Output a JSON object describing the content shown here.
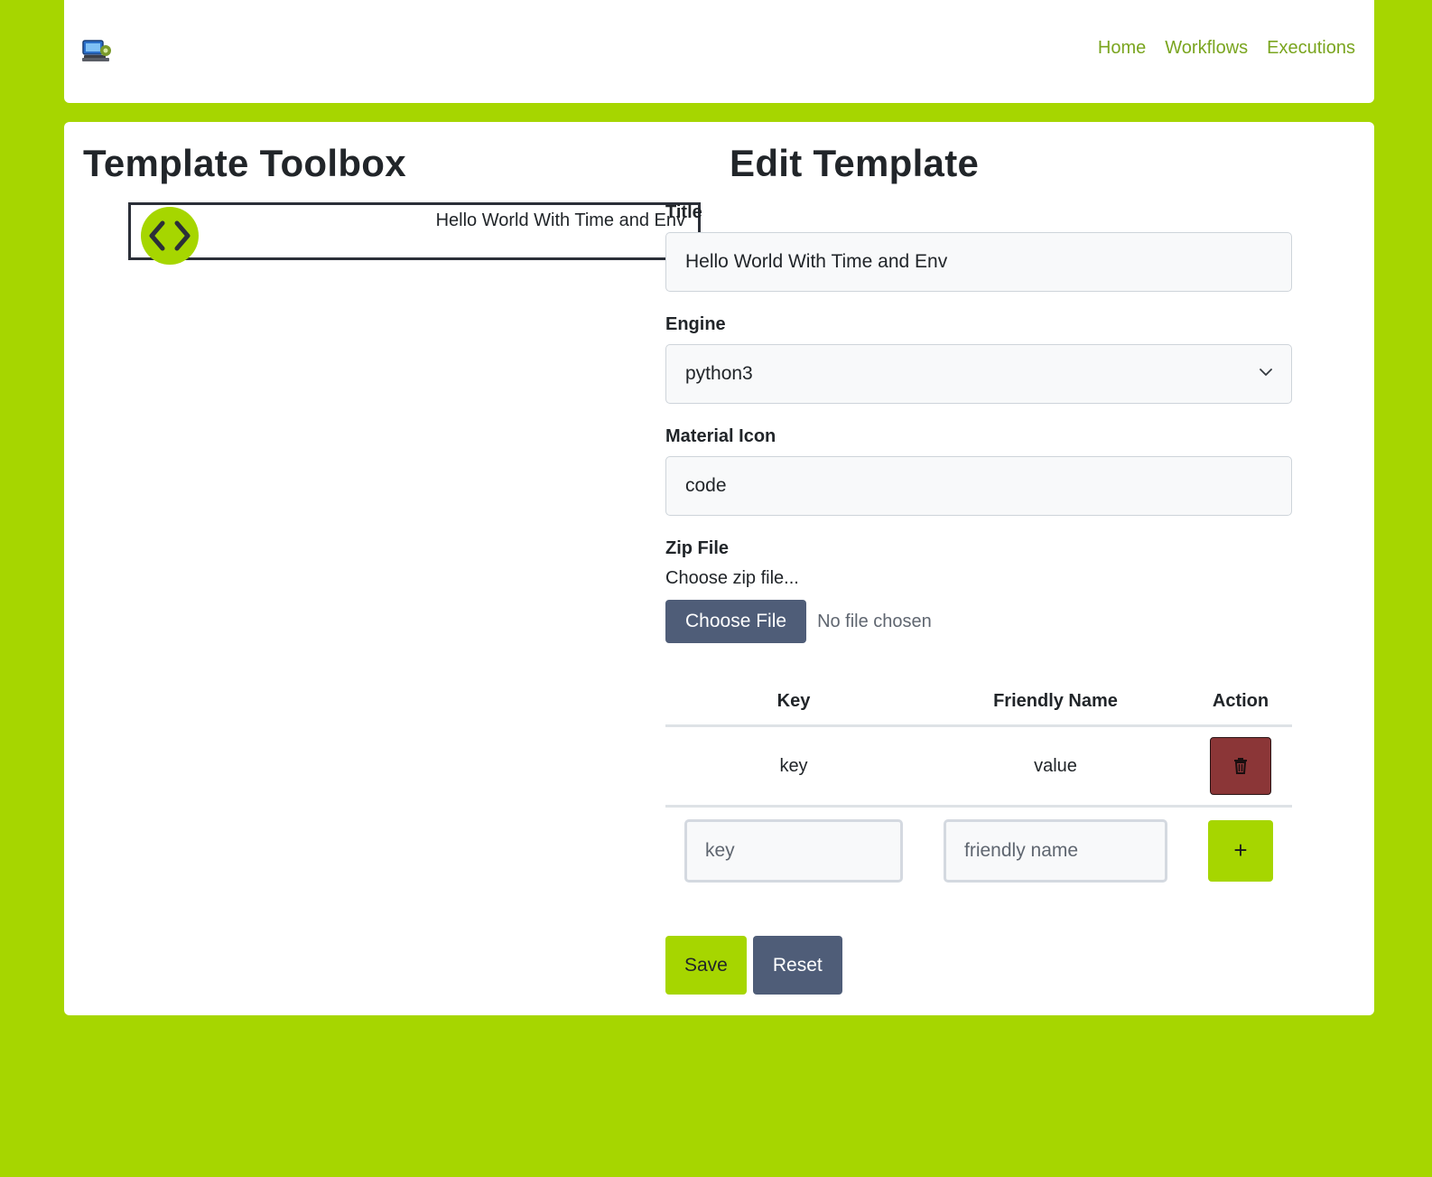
{
  "nav": {
    "logo_icon": "computer-gear-logo",
    "links": [
      {
        "label": "Home"
      },
      {
        "label": "Workflows"
      },
      {
        "label": "Executions"
      }
    ],
    "link_color": "#7aa51f"
  },
  "toolbox": {
    "title": "Template Toolbox",
    "items": [
      {
        "label": "Hello World With Time and Env",
        "icon": "code-icon"
      }
    ]
  },
  "edit": {
    "title": "Edit Template",
    "title_label": "Title",
    "title_value": "Hello World With Time and Env",
    "engine_label": "Engine",
    "engine_value": "python3",
    "icon_label": "Material Icon",
    "icon_value": "code",
    "zip_label": "Zip File",
    "zip_hint": "Choose zip file...",
    "choose_button": "Choose File",
    "no_file": "No file chosen"
  },
  "env_table": {
    "headers": {
      "key": "Key",
      "name": "Friendly Name",
      "action": "Action"
    },
    "rows": [
      {
        "key": "key",
        "name": "value"
      }
    ],
    "new_key_placeholder": "key",
    "new_name_placeholder": "friendly name",
    "add_label": "+"
  },
  "actions": {
    "save": "Save",
    "reset": "Reset"
  },
  "colors": {
    "accent": "#a6d600",
    "secondary": "#4f5d78",
    "danger": "#8b3637"
  }
}
